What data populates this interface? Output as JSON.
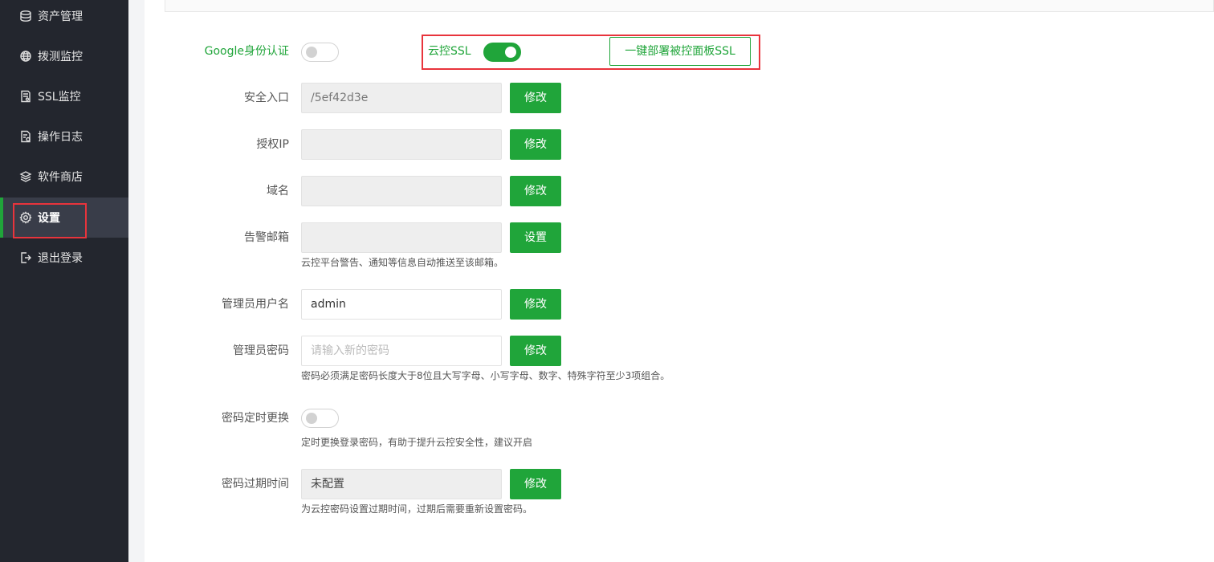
{
  "sidebar": {
    "items": [
      {
        "label": "资产管理",
        "icon": "database-icon"
      },
      {
        "label": "拨测监控",
        "icon": "globe-icon"
      },
      {
        "label": "SSL监控",
        "icon": "certificate-icon"
      },
      {
        "label": "操作日志",
        "icon": "log-icon"
      },
      {
        "label": "软件商店",
        "icon": "layers-icon"
      },
      {
        "label": "设置",
        "icon": "gear-icon"
      },
      {
        "label": "退出登录",
        "icon": "logout-icon"
      }
    ],
    "active_index": 5
  },
  "settings": {
    "google_auth": {
      "label": "Google身份认证",
      "enabled": false
    },
    "cloud_ssl": {
      "label": "云控SSL",
      "enabled": true,
      "deploy_button": "一键部署被控面板SSL"
    },
    "security_entry": {
      "label": "安全入口",
      "value": "/5ef42d3e",
      "button": "修改"
    },
    "authorized_ip": {
      "label": "授权IP",
      "value": "",
      "button": "修改"
    },
    "domain": {
      "label": "域名",
      "value": "",
      "button": "修改"
    },
    "alert_email": {
      "label": "告警邮箱",
      "value": "",
      "button": "设置",
      "tip": "云控平台警告、通知等信息自动推送至该邮箱。"
    },
    "admin_username": {
      "label": "管理员用户名",
      "value": "admin",
      "button": "修改"
    },
    "admin_password": {
      "label": "管理员密码",
      "placeholder": "请输入新的密码",
      "button": "修改",
      "tip": "密码必须满足密码长度大于8位且大写字母、小写字母、数字、特殊字符至少3项组合。"
    },
    "password_rotation": {
      "label": "密码定时更换",
      "enabled": false,
      "tip": "定时更换登录密码，有助于提升云控安全性，建议开启"
    },
    "password_expiry": {
      "label": "密码过期时间",
      "value": "未配置",
      "button": "修改",
      "tip": "为云控密码设置过期时间，过期后需要重新设置密码。"
    }
  },
  "colors": {
    "accent": "#20a53a",
    "sidebar_bg": "#23262e",
    "highlight": "#e8343c"
  }
}
